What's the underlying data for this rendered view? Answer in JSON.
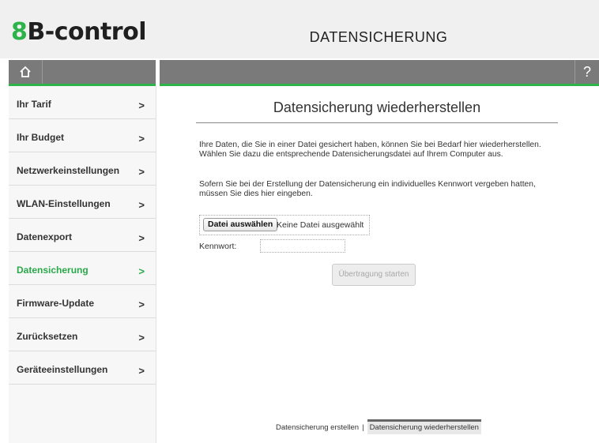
{
  "header": {
    "logo_part1": "8",
    "logo_part2": "B-control",
    "title": "DATENSICHERUNG",
    "help_label": "?"
  },
  "icons": {
    "home": "home-icon",
    "chevron": "chevron-right-icon"
  },
  "colors": {
    "accent": "#2db34a",
    "bar": "#7a7a7a"
  },
  "sidebar": {
    "chevron": ">",
    "items": [
      {
        "label": "Ihr Tarif"
      },
      {
        "label": "Ihr Budget"
      },
      {
        "label": "Netzwerkeinstellungen"
      },
      {
        "label": "WLAN-Einstellungen"
      },
      {
        "label": "Datenexport"
      },
      {
        "label": "Datensicherung",
        "active": true
      },
      {
        "label": "Firmware-Update"
      },
      {
        "label": "Zurücksetzen"
      },
      {
        "label": "Geräteeinstellungen"
      }
    ]
  },
  "main": {
    "heading": "Datensicherung wiederherstellen",
    "paragraph1": "Ihre Daten, die Sie in einer Datei gesichert haben, können Sie bei Bedarf hier wiederherstellen. Wählen Sie dazu die entsprechende Datensicherungsdatei auf Ihrem Computer aus.",
    "paragraph2": "Sofern Sie bei der Erstellung der Datensicherung ein individuelles Kennwort vergeben hatten, müssen Sie dies hier eingeben.",
    "file_button": "Datei auswählen",
    "file_status": "Keine Datei ausgewählt",
    "password_label": "Kennwort:",
    "password_value": "",
    "submit_button": "Übertragung starten"
  },
  "tabs": {
    "create": "Datensicherung erstellen",
    "separator": "|",
    "restore": "Datensicherung wiederherstellen"
  }
}
